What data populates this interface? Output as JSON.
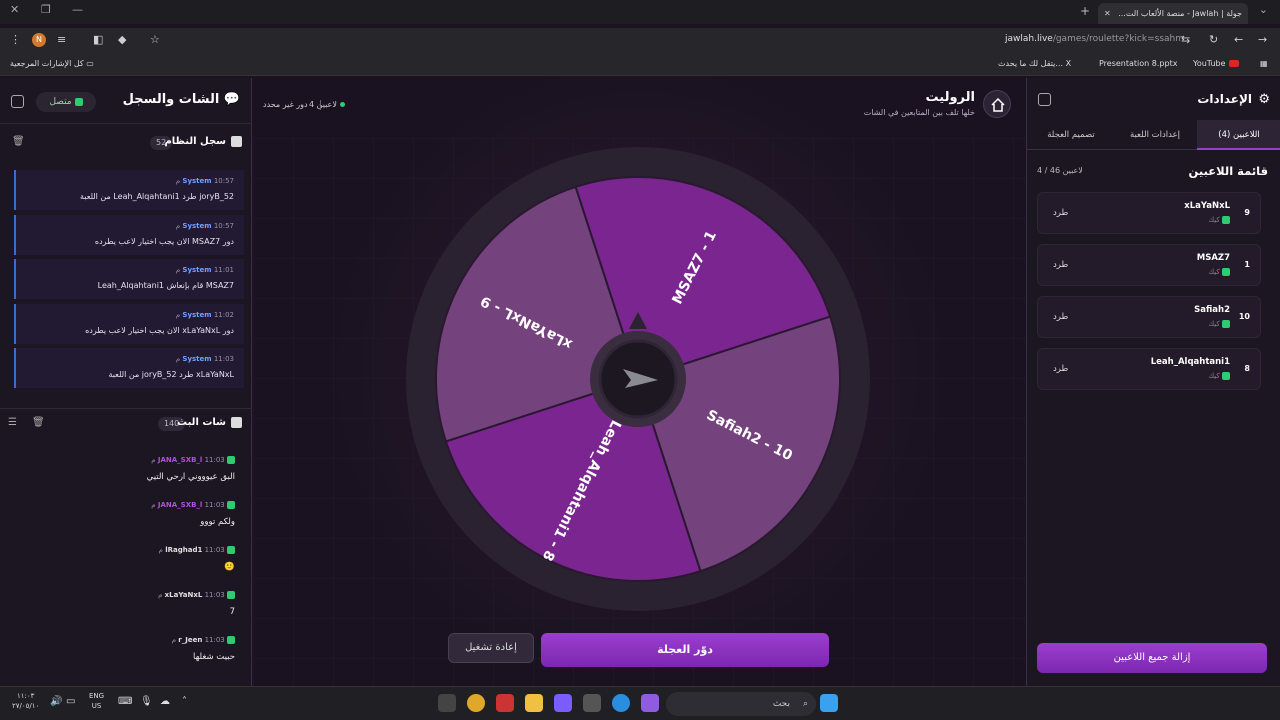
{
  "browser": {
    "tab_title": "جولة | Jawlah - منصة الألعاب الت...",
    "url_host": "jawlah.live",
    "url_path": "/games/roulette?kick=ssahm",
    "bookmarks": [
      "YouTube",
      "Presentation 8.pptx",
      "يتقل لك ما يحدث... X",
      "كل الإشارات المرجعية"
    ]
  },
  "chat_panel": {
    "title": "الشات والسجل",
    "status": "متصل",
    "system_log": {
      "title": "سجل النظام",
      "count": "52",
      "messages": [
        {
          "sender": "System",
          "time": "10:57 م",
          "text": "joryB_52 طرد Leah_Alqahtani1 من اللعبة"
        },
        {
          "sender": "System",
          "time": "10:57 م",
          "text": "دور MSAZ7 الان يجب اختيار لاعب يطرده"
        },
        {
          "sender": "System",
          "time": "11:01 م",
          "text": "MSAZ7 قام بإنعاش Leah_Alqahtani1"
        },
        {
          "sender": "System",
          "time": "11:02 م",
          "text": "دور xLaYaNxL الان يجب اختيار لاعب يطرده"
        },
        {
          "sender": "System",
          "time": "11:03 م",
          "text": "xLaYaNxL طرد joryB_52 من اللعبة"
        }
      ]
    },
    "stream_chat": {
      "title": "شات البث",
      "count": "140",
      "messages": [
        {
          "user": "JANA_SXB_l",
          "time": "11:03 م",
          "text": "البق عيوووني ارحي التيي",
          "color": "#b14fe0"
        },
        {
          "user": "JANA_SXB_l",
          "time": "11:03 م",
          "text": "ولكم تووو",
          "color": "#b14fe0"
        },
        {
          "user": "lRaghad1",
          "time": "11:03 م",
          "text": "",
          "color": "#e0e0e0"
        },
        {
          "user": "xLaYaNxL",
          "time": "11:03 م",
          "text": "7",
          "color": "#e0e0e0"
        },
        {
          "user": "r_Jeen",
          "time": "11:03 م",
          "text": "حبيت شغلها",
          "color": "#e0e0e0"
        }
      ]
    }
  },
  "game": {
    "title": "الروليت",
    "subtitle": "خلها تلف بين المتابعين في الشات",
    "players_count": "4 لاعبين",
    "turn": "دور غير محدد",
    "wheel_segments": [
      {
        "label": "MSAZ7 - 1",
        "color": "#7b2591"
      },
      {
        "label": "Safiah2 - 10",
        "color": "#74437e"
      },
      {
        "label": "Leah_Alqahtani1 - 8",
        "color": "#7b2591"
      },
      {
        "label": "xLaYaNxL - 9",
        "color": "#74437e"
      }
    ],
    "reset_label": "إعادة تشغيل",
    "spin_label": "دوّر العجلة"
  },
  "settings": {
    "title": "الإعدادات",
    "tabs": [
      "اللاعبين (4)",
      "إعدادات اللعبة",
      "تصميم العجلة"
    ],
    "players_title": "قائمة اللاعبين",
    "players_limit": "4 / 46 لاعبين",
    "platform": "كيك",
    "kick_label": "طرد",
    "players": [
      {
        "name": "xLaYaNxL",
        "number": "9"
      },
      {
        "name": "MSAZ7",
        "number": "1"
      },
      {
        "name": "Safiah2",
        "number": "10"
      },
      {
        "name": "Leah_Alqahtani1",
        "number": "8"
      }
    ],
    "remove_all": "إزالة جميع اللاعبين"
  },
  "taskbar": {
    "search": "بحث",
    "time": "١١:٠٣",
    "date": "٢٧/٠٥/١٠",
    "lang": "ENG",
    "region": "US"
  }
}
